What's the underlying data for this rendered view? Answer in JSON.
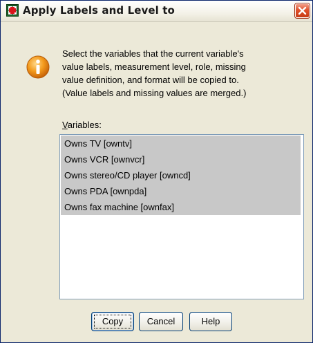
{
  "window": {
    "title": "Apply Labels and Level to",
    "close_icon": "close-icon",
    "app_icon": "spss-dialog-icon"
  },
  "message": {
    "icon": "info-icon",
    "text": "Select the variables that the current variable's\nvalue labels, measurement level, role, missing\nvalue definition, and format will be copied to.\n(Value labels and missing values are merged.)"
  },
  "variables": {
    "label_mnemonic": "V",
    "label_rest": "ariables:",
    "items": [
      "Owns TV [owntv]",
      "Owns VCR [ownvcr]",
      "Owns stereo/CD player [owncd]",
      "Owns PDA [ownpda]",
      "Owns fax machine [ownfax]"
    ]
  },
  "buttons": {
    "copy": "Copy",
    "cancel": "Cancel",
    "help": "Help"
  },
  "colors": {
    "selection": "#c8c8c8",
    "dialog_bg": "#ece9d8",
    "close_red": "#e0502a"
  }
}
